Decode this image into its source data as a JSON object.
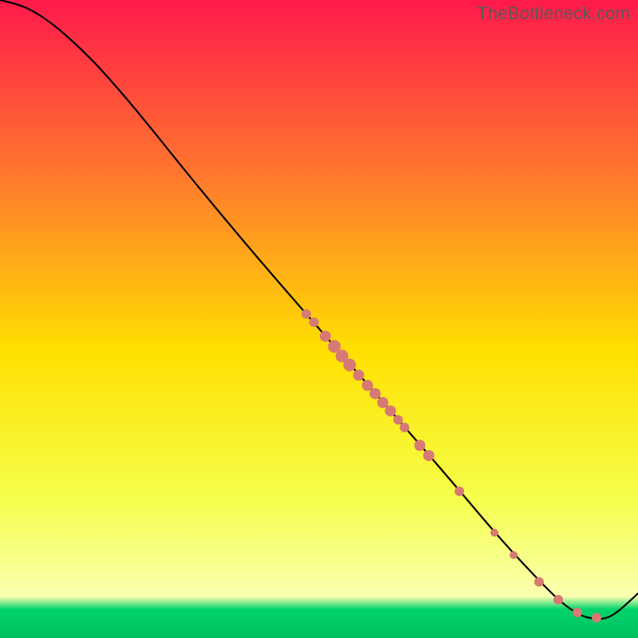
{
  "watermark": "TheBottleneck.com",
  "chart_data": {
    "type": "line",
    "title": "",
    "xlabel": "",
    "ylabel": "",
    "xlim": [
      0,
      100
    ],
    "ylim": [
      0,
      100
    ],
    "background_gradient": {
      "top": "#ff1a4b",
      "mid_upper": "#ff7a2d",
      "mid": "#ffe000",
      "mid_lower": "#f5ff4a",
      "green_band": "#00d46a",
      "bottom": "#00c060"
    },
    "curve": [
      {
        "x": 0,
        "y": 100.0
      },
      {
        "x": 4,
        "y": 99.0
      },
      {
        "x": 8,
        "y": 96.5
      },
      {
        "x": 12,
        "y": 93.0
      },
      {
        "x": 16,
        "y": 89.0
      },
      {
        "x": 22,
        "y": 82.0
      },
      {
        "x": 30,
        "y": 72.0
      },
      {
        "x": 40,
        "y": 60.0
      },
      {
        "x": 50,
        "y": 48.5
      },
      {
        "x": 60,
        "y": 37.0
      },
      {
        "x": 70,
        "y": 25.5
      },
      {
        "x": 78,
        "y": 16.0
      },
      {
        "x": 84,
        "y": 9.5
      },
      {
        "x": 88,
        "y": 5.5
      },
      {
        "x": 91,
        "y": 3.5
      },
      {
        "x": 93,
        "y": 3.0
      },
      {
        "x": 95,
        "y": 3.0
      },
      {
        "x": 97,
        "y": 4.2
      },
      {
        "x": 100,
        "y": 7.0
      }
    ],
    "dots": [
      {
        "x": 48.0,
        "y": 50.8,
        "r": 6
      },
      {
        "x": 49.2,
        "y": 49.5,
        "r": 6
      },
      {
        "x": 51.0,
        "y": 47.3,
        "r": 7
      },
      {
        "x": 52.4,
        "y": 45.7,
        "r": 8
      },
      {
        "x": 53.6,
        "y": 44.2,
        "r": 8
      },
      {
        "x": 54.8,
        "y": 42.8,
        "r": 8
      },
      {
        "x": 56.2,
        "y": 41.2,
        "r": 7
      },
      {
        "x": 57.6,
        "y": 39.6,
        "r": 7
      },
      {
        "x": 58.8,
        "y": 38.3,
        "r": 7
      },
      {
        "x": 60.0,
        "y": 36.9,
        "r": 7
      },
      {
        "x": 61.2,
        "y": 35.6,
        "r": 7
      },
      {
        "x": 62.4,
        "y": 34.2,
        "r": 6
      },
      {
        "x": 63.4,
        "y": 33.0,
        "r": 6
      },
      {
        "x": 65.8,
        "y": 30.2,
        "r": 7
      },
      {
        "x": 67.2,
        "y": 28.6,
        "r": 7
      },
      {
        "x": 72.0,
        "y": 23.0,
        "r": 6
      },
      {
        "x": 77.5,
        "y": 16.5,
        "r": 5
      },
      {
        "x": 80.5,
        "y": 13.0,
        "r": 5
      },
      {
        "x": 84.5,
        "y": 8.8,
        "r": 6
      },
      {
        "x": 87.5,
        "y": 6.0,
        "r": 6
      },
      {
        "x": 90.5,
        "y": 4.0,
        "r": 6
      },
      {
        "x": 93.5,
        "y": 3.2,
        "r": 6
      }
    ],
    "dot_color": "#d77a73"
  }
}
